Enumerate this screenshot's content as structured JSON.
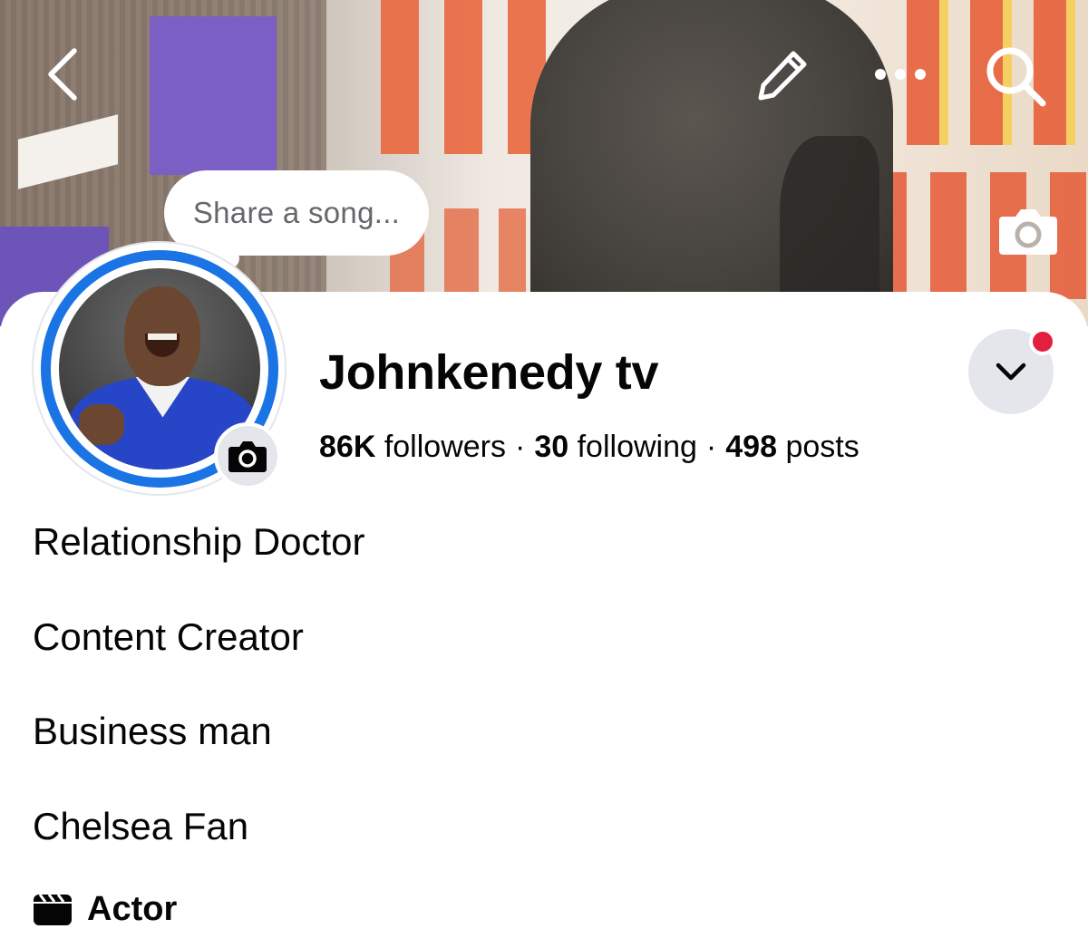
{
  "header": {
    "back_icon": "chevron-left-icon",
    "edit_icon": "pencil-icon",
    "more_icon": "more-horizontal-icon",
    "search_icon": "search-icon",
    "cover_camera_icon": "camera-icon"
  },
  "song_prompt": {
    "placeholder": "Share a song..."
  },
  "profile": {
    "name": "Johnkenedy tv",
    "avatar_ring_color": "#1b74e4",
    "avatar_camera_icon": "camera-icon",
    "stats": {
      "followers_count": "86K",
      "followers_label": "followers",
      "following_count": "30",
      "following_label": "following",
      "posts_count": "498",
      "posts_label": "posts",
      "separator": "·"
    },
    "dropdown_icon": "chevron-down-icon",
    "notification_dot_color": "#e41e3f"
  },
  "bio": {
    "lines": [
      "Relationship Doctor",
      "Content Creator",
      "Business man",
      "Chelsea Fan"
    ],
    "category_icon": "clapperboard-icon",
    "category": "Actor"
  }
}
